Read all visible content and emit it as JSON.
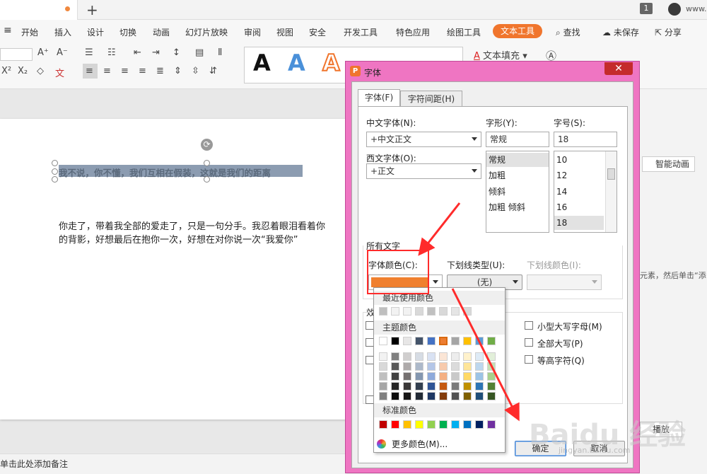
{
  "tabbar": {
    "new_tab": "+",
    "notification_count": "1",
    "site": "www."
  },
  "menu": {
    "items": [
      "开始",
      "插入",
      "设计",
      "切换",
      "动画",
      "幻灯片放映",
      "审阅",
      "视图",
      "安全",
      "开发工具",
      "特色应用",
      "绘图工具",
      "文本工具",
      "查找",
      "未保存",
      "分享"
    ],
    "active": "文本工具"
  },
  "ribbon": {
    "wordart_letter": "A",
    "text_fill": "文本填充",
    "font_grow": "A⁺",
    "font_shrink": "A⁻"
  },
  "slide": {
    "selected_text": "我不说，你不懂，我们互相在假装，这就是我们的距离",
    "body_line1": "你走了，带着我全部的爱走了，只是一句分手。我忍着眼泪看着你",
    "body_line2": "的背影，好想最后在抱你一次，好想在对你说一次“我爱你”"
  },
  "notes": {
    "placeholder": "单击此处添加备注"
  },
  "right_panel": {
    "smart_animation": "智能动画",
    "hint": "元素，然后单击“添",
    "play": "播放"
  },
  "dialog": {
    "title": "字体",
    "close": "✕",
    "tabs": [
      "字体(F)",
      "字符间距(H)"
    ],
    "cn_font_label": "中文字体(N):",
    "cn_font_value": "+中文正文",
    "west_font_label": "西文字体(O):",
    "west_font_value": "+正文",
    "style_label": "字形(Y):",
    "style_value": "常规",
    "style_options": [
      "常规",
      "加粗",
      "倾斜",
      "加粗 倾斜"
    ],
    "size_label": "字号(S):",
    "size_value": "18",
    "size_options": [
      "10",
      "12",
      "14",
      "16",
      "18"
    ],
    "all_text_label": "所有文字",
    "font_color_label": "字体颜色(C):",
    "underline_label": "下划线类型(U):",
    "underline_value": "(无)",
    "underline_color_label": "下划线颜色(I):",
    "effects_label": "效",
    "small_caps": "小型大写字母(M)",
    "all_caps": "全部大写(P)",
    "equal_height": "等高字符(Q)",
    "ok": "确定",
    "cancel": "取消",
    "selected_color": "#f0802f"
  },
  "palette": {
    "recent_label": "最近使用颜色",
    "theme_label": "主题颜色",
    "standard_label": "标准颜色",
    "more_colors": "更多颜色(M)...",
    "recent": [
      "#bfbfbf",
      "#f2f2f2",
      "#f2f2f2",
      "#d9d9d9",
      "#c0c0c0",
      "#d9d9d9",
      "#e5e5e5",
      "#d9d9d9"
    ],
    "theme_top": [
      "#ffffff",
      "#000000",
      "#e7e6e6",
      "#44546a",
      "#4472c4",
      "#ed7d31",
      "#a5a5a5",
      "#ffc000",
      "#5b9bd5",
      "#70ad47"
    ],
    "theme_cols": [
      [
        "#f2f2f2",
        "#d9d9d9",
        "#bfbfbf",
        "#a6a6a6",
        "#808080"
      ],
      [
        "#808080",
        "#595959",
        "#404040",
        "#262626",
        "#0d0d0d"
      ],
      [
        "#d0cece",
        "#aeaaaa",
        "#757171",
        "#3a3838",
        "#171616"
      ],
      [
        "#d6dce4",
        "#adb9ca",
        "#8497b0",
        "#333f4f",
        "#222a35"
      ],
      [
        "#d9e2f3",
        "#b4c6e7",
        "#8eaadb",
        "#2f5496",
        "#1f3864"
      ],
      [
        "#fbe5d5",
        "#f7caac",
        "#f4b083",
        "#c55a11",
        "#833c0b"
      ],
      [
        "#ededed",
        "#dbdbdb",
        "#c9c9c9",
        "#7b7b7b",
        "#525252"
      ],
      [
        "#fff2cc",
        "#fee599",
        "#ffd965",
        "#bf9000",
        "#7f6000"
      ],
      [
        "#deebf6",
        "#bdd7ee",
        "#9cc3e5",
        "#2e75b5",
        "#1f4e79"
      ],
      [
        "#e2efd9",
        "#c5e0b3",
        "#a8d08d",
        "#538135",
        "#375623"
      ]
    ],
    "standard": [
      "#c00000",
      "#ff0000",
      "#ffc000",
      "#ffff00",
      "#92d050",
      "#00b050",
      "#00b0f0",
      "#0070c0",
      "#002060",
      "#7030a0"
    ]
  },
  "watermark": {
    "text": "Baidu 经验",
    "sub": "jingyan.baidu.com"
  }
}
